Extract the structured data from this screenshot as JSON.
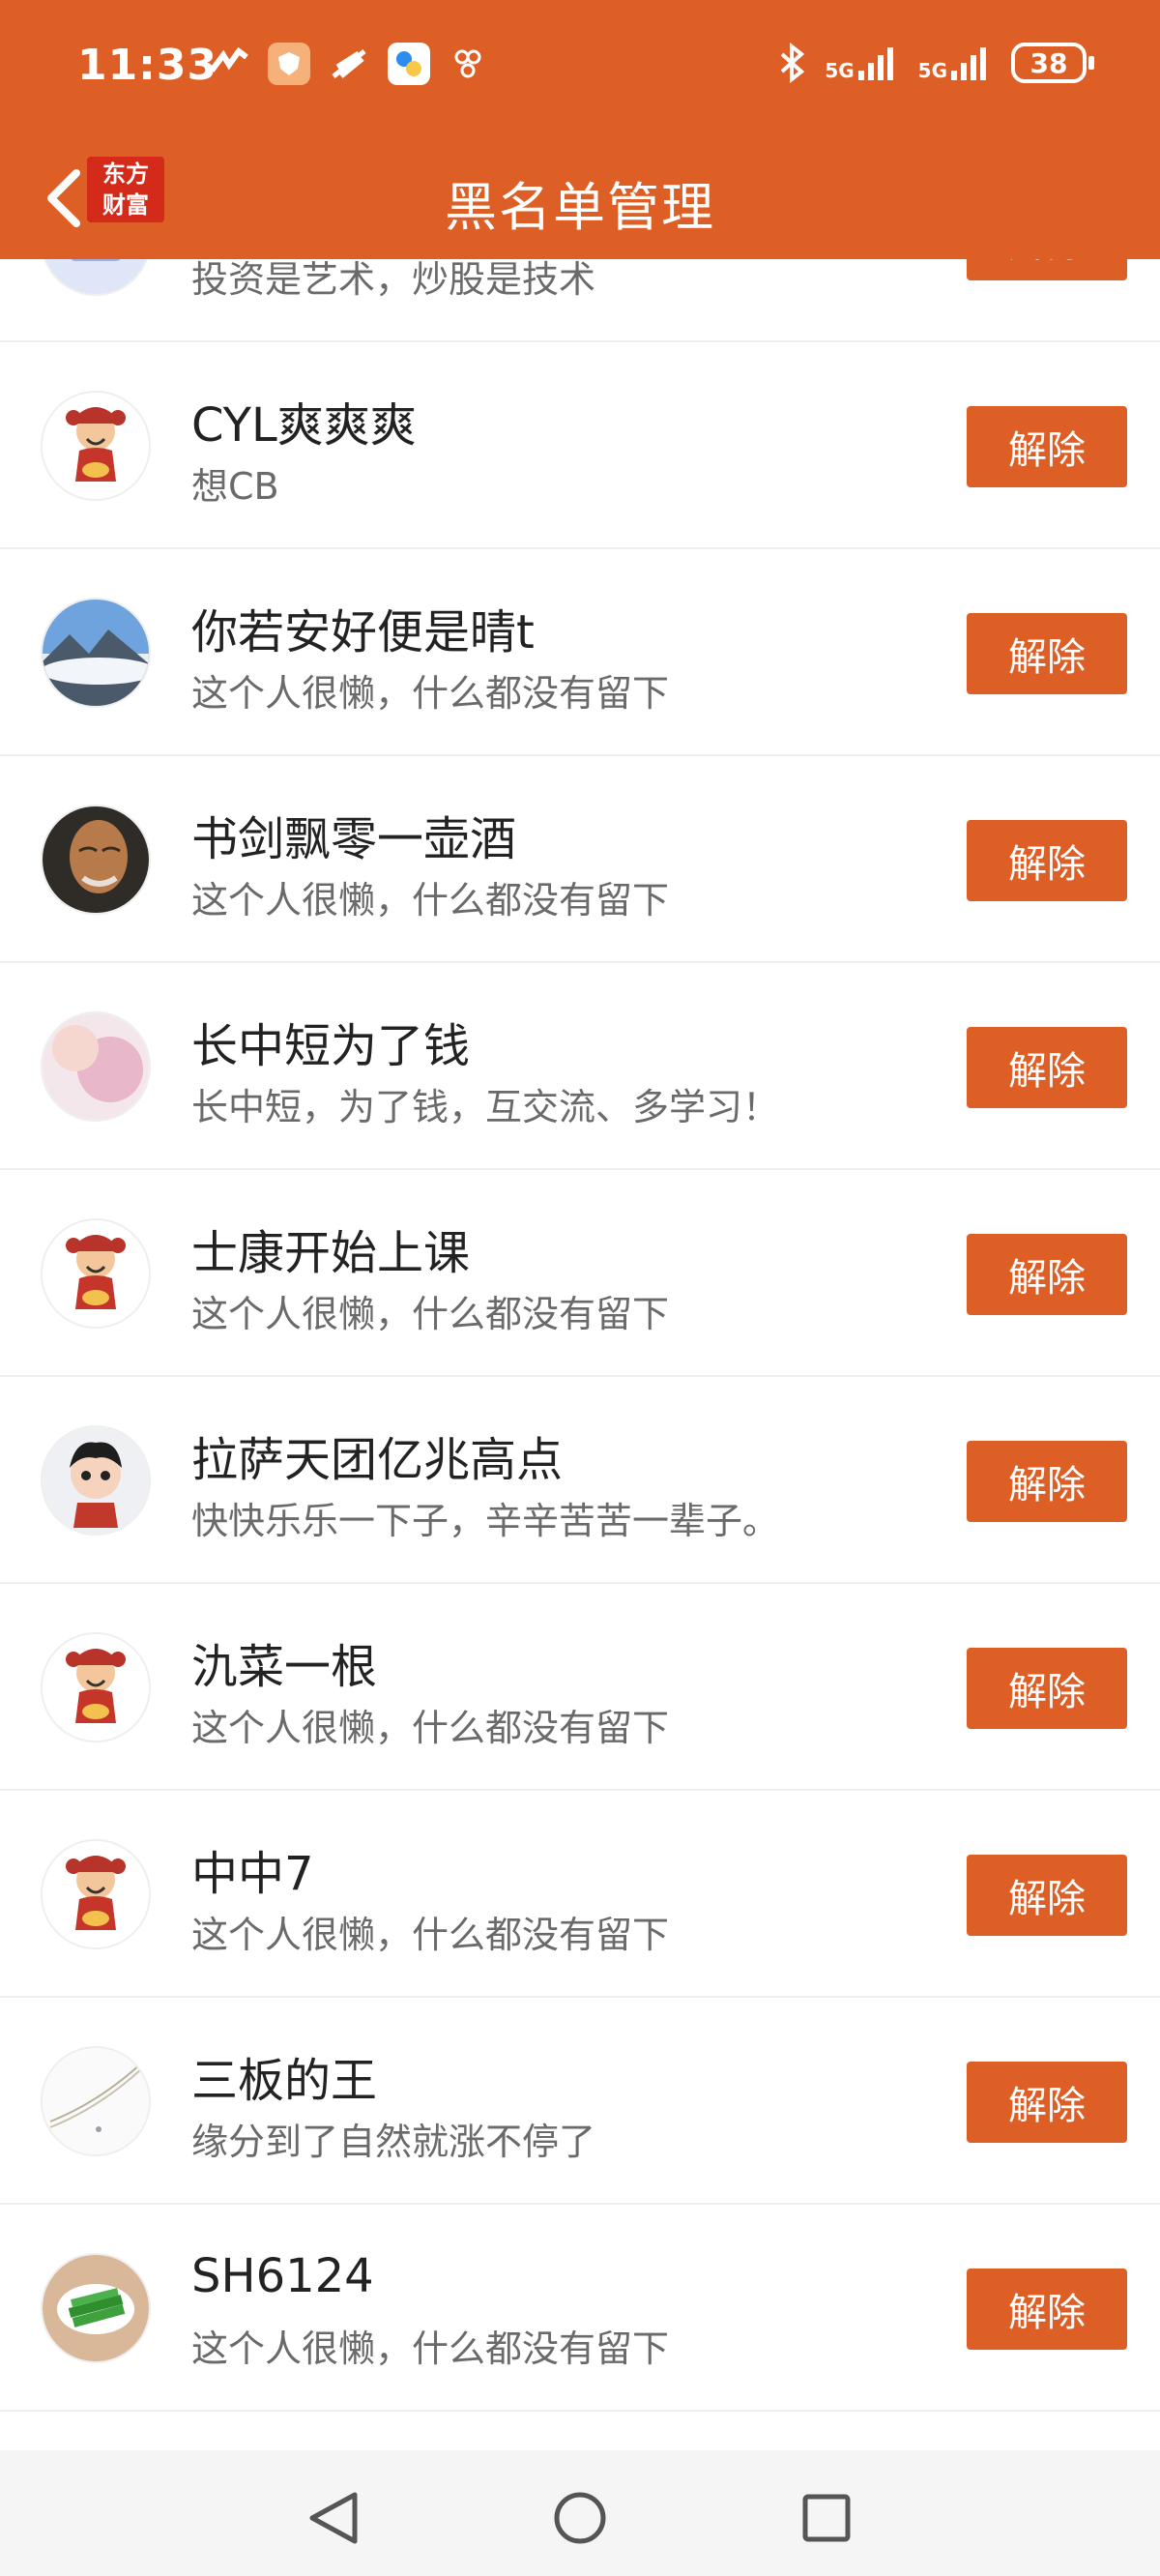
{
  "statusbar": {
    "time": "11:33",
    "battery": "38",
    "net1": "5G",
    "net2": "5G"
  },
  "titlebar": {
    "title": "黑名单管理",
    "logo_line1": "东方",
    "logo_line2": "财富"
  },
  "rows": [
    {
      "name": "",
      "desc": "投资是艺术，炒股是技术",
      "button": "解除",
      "avatar": "blue-placeholder-icon"
    },
    {
      "name": "CYL爽爽爽",
      "desc": "想CB",
      "button": "解除",
      "avatar": "fortune-god-icon"
    },
    {
      "name": "你若安好便是晴t",
      "desc": "这个人很懒，什么都没有留下",
      "button": "解除",
      "avatar": "mountain-landscape-icon"
    },
    {
      "name": "书剑飘零一壶酒",
      "desc": "这个人很懒，什么都没有留下",
      "button": "解除",
      "avatar": "old-man-portrait-icon"
    },
    {
      "name": "长中短为了钱",
      "desc": "长中短，为了钱，互交流、多学习！",
      "button": "解除",
      "avatar": "pink-portrait-icon"
    },
    {
      "name": "士康开始上课",
      "desc": "这个人很懒，什么都没有留下",
      "button": "解除",
      "avatar": "fortune-god-icon"
    },
    {
      "name": "拉萨天团亿兆高点",
      "desc": "快快乐乐一下子，辛辛苦苦一辈子。",
      "button": "解除",
      "avatar": "cartoon-boy-icon"
    },
    {
      "name": "氿菜一根",
      "desc": "这个人很懒，什么都没有留下",
      "button": "解除",
      "avatar": "fortune-god-icon"
    },
    {
      "name": "中中7",
      "desc": "这个人很懒，什么都没有留下",
      "button": "解除",
      "avatar": "fortune-god-icon"
    },
    {
      "name": "三板的王",
      "desc": "缘分到了自然就涨不停了",
      "button": "解除",
      "avatar": "sketch-lines-icon"
    },
    {
      "name": "SH6124",
      "desc": "这个人很懒，什么都没有留下",
      "button": "解除",
      "avatar": "green-vegetables-icon"
    }
  ],
  "colors": {
    "accent": "#DE5F26"
  }
}
